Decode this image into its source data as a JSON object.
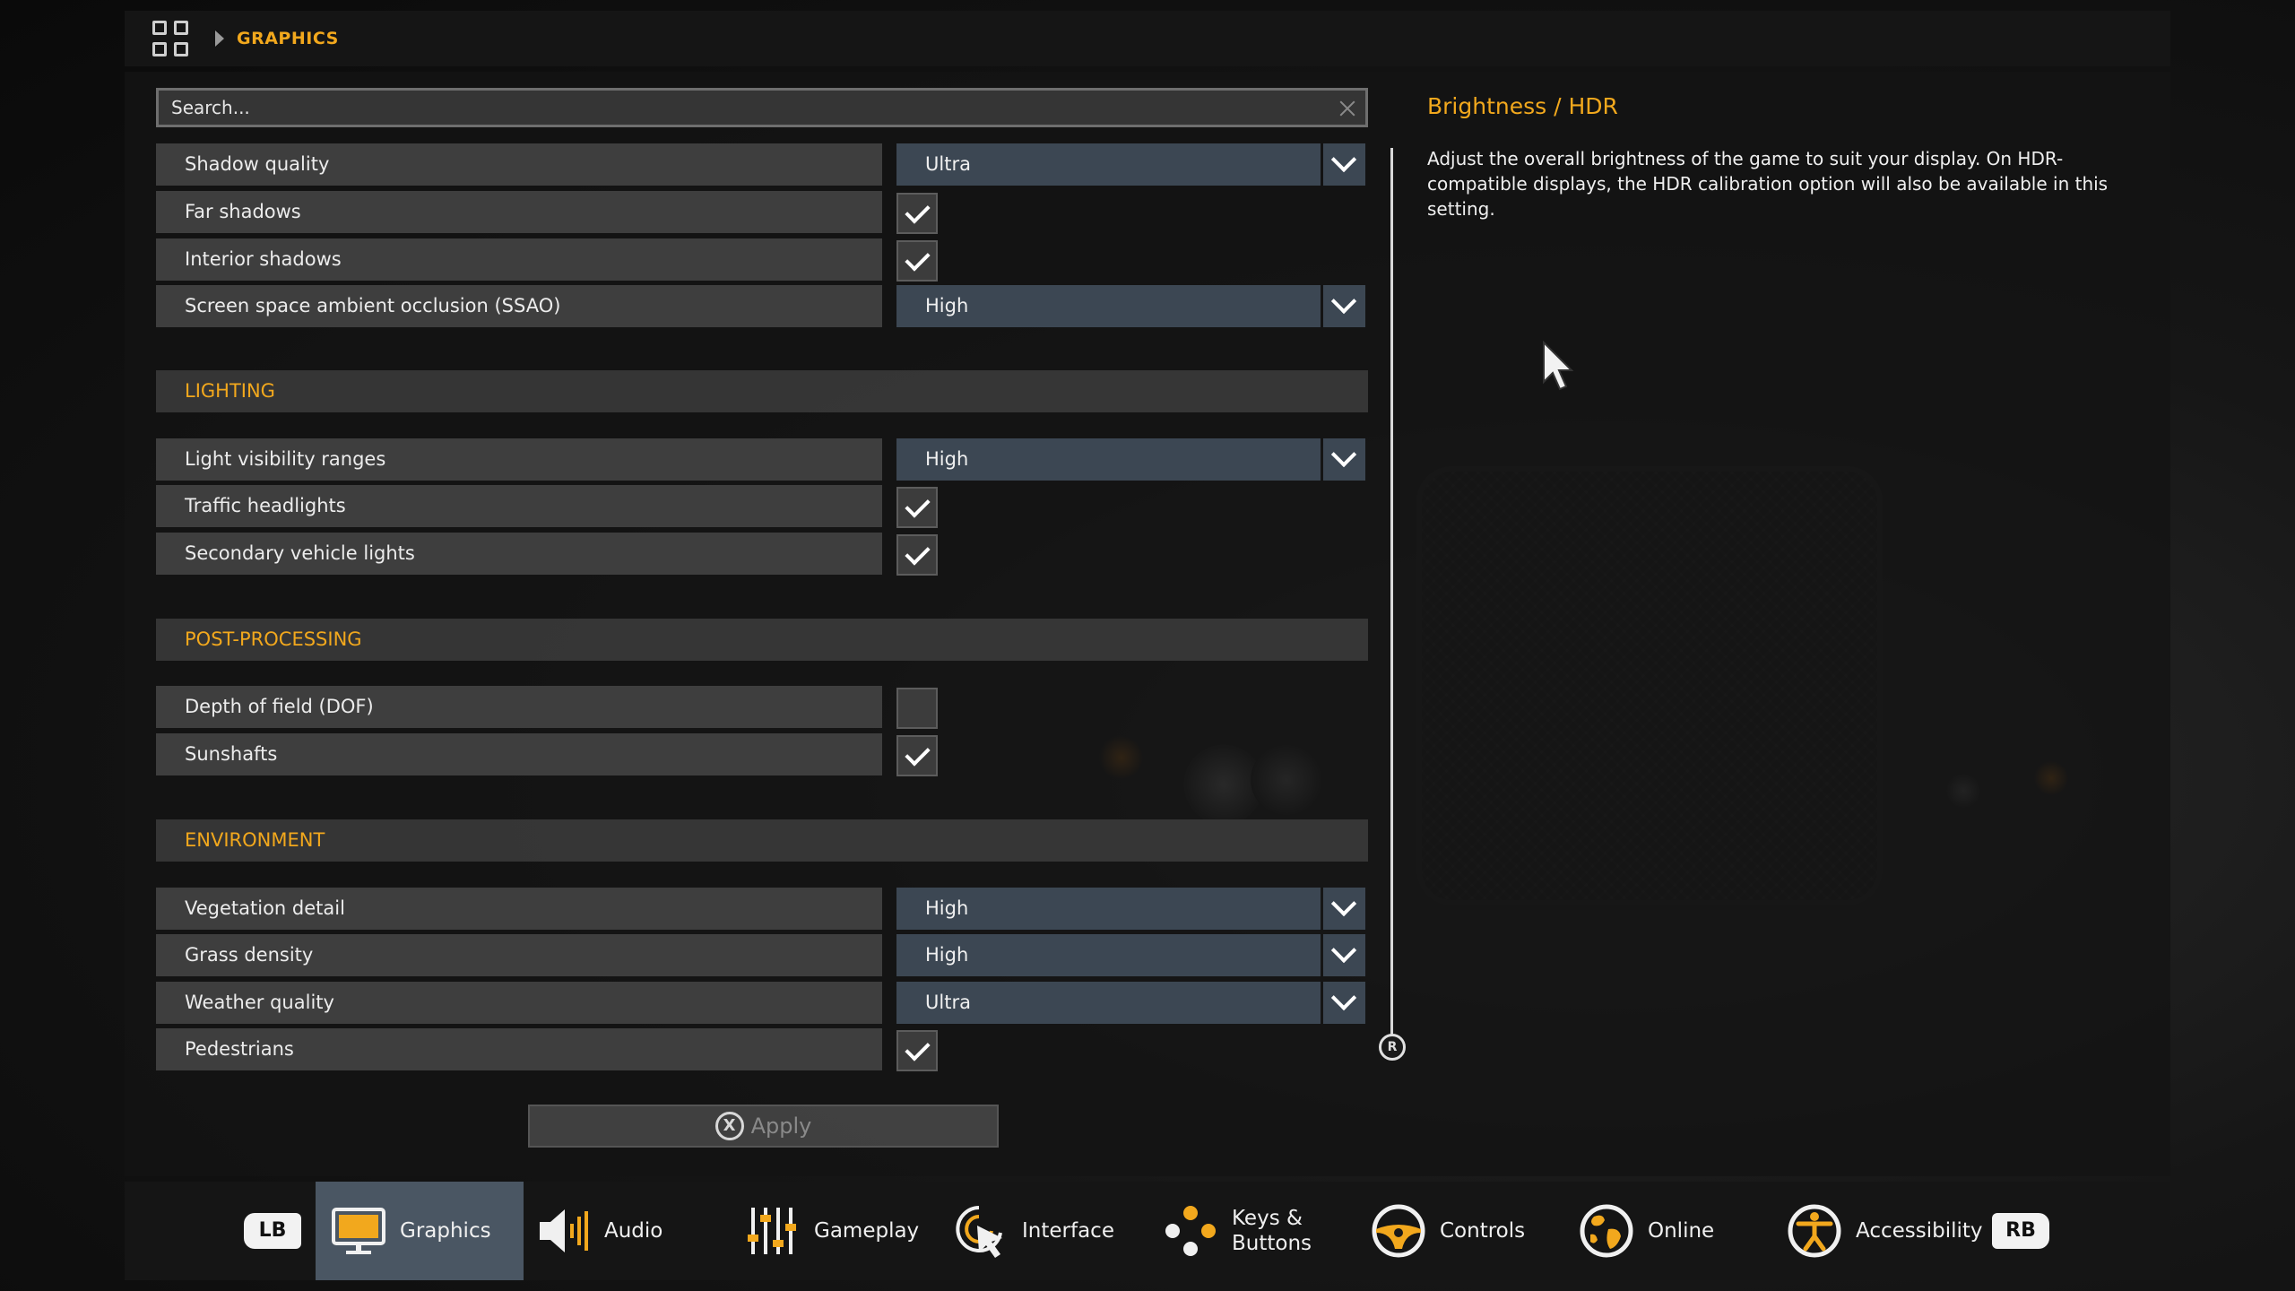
{
  "breadcrumb": {
    "section": "GRAPHICS"
  },
  "search": {
    "placeholder": "Search..."
  },
  "settings": [
    {
      "label": "Shadow quality",
      "type": "select",
      "value": "Ultra"
    },
    {
      "label": "Far shadows",
      "type": "checkbox",
      "checked": true
    },
    {
      "label": "Interior shadows",
      "type": "checkbox",
      "checked": true
    },
    {
      "label": "Screen space ambient occlusion (SSAO)",
      "type": "select",
      "value": "High"
    }
  ],
  "sections": {
    "lighting": {
      "title": "LIGHTING",
      "items": [
        {
          "label": "Light visibility ranges",
          "type": "select",
          "value": "High"
        },
        {
          "label": "Traffic headlights",
          "type": "checkbox",
          "checked": true
        },
        {
          "label": "Secondary vehicle lights",
          "type": "checkbox",
          "checked": true
        }
      ]
    },
    "post_processing": {
      "title": "POST-PROCESSING",
      "items": [
        {
          "label": "Depth of field (DOF)",
          "type": "checkbox",
          "checked": false
        },
        {
          "label": "Sunshafts",
          "type": "checkbox",
          "checked": true
        }
      ]
    },
    "environment": {
      "title": "ENVIRONMENT",
      "items": [
        {
          "label": "Vegetation detail",
          "type": "select",
          "value": "High"
        },
        {
          "label": "Grass density",
          "type": "select",
          "value": "High"
        },
        {
          "label": "Weather quality",
          "type": "select",
          "value": "Ultra"
        },
        {
          "label": "Pedestrians",
          "type": "checkbox",
          "checked": true
        }
      ]
    }
  },
  "apply": {
    "button_glyph": "X",
    "label": "Apply"
  },
  "scroll_knob_glyph": "R",
  "description": {
    "title": "Brightness / HDR",
    "text": "Adjust the overall brightness of the game to suit your display. On HDR-compatible displays, the HDR calibration option will also be available in this setting."
  },
  "tabs": {
    "lb": "LB",
    "rb": "RB",
    "items": [
      {
        "label": "Graphics",
        "icon": "monitor-icon",
        "active": true
      },
      {
        "label": "Audio",
        "icon": "speaker-icon",
        "active": false
      },
      {
        "label": "Gameplay",
        "icon": "sliders-icon",
        "active": false
      },
      {
        "label": "Interface",
        "icon": "cursor-click-icon",
        "active": false
      },
      {
        "label": "Keys &",
        "label2": "Buttons",
        "icon": "gamepad-buttons-icon",
        "active": false
      },
      {
        "label": "Controls",
        "icon": "steering-wheel-icon",
        "active": false
      },
      {
        "label": "Online",
        "icon": "globe-icon",
        "active": false
      },
      {
        "label": "Accessibility",
        "icon": "accessibility-icon",
        "active": false
      }
    ]
  },
  "colors": {
    "accent": "#f2a81d",
    "active_tab": "#4a5663",
    "select_bg": "#3e4a56"
  }
}
